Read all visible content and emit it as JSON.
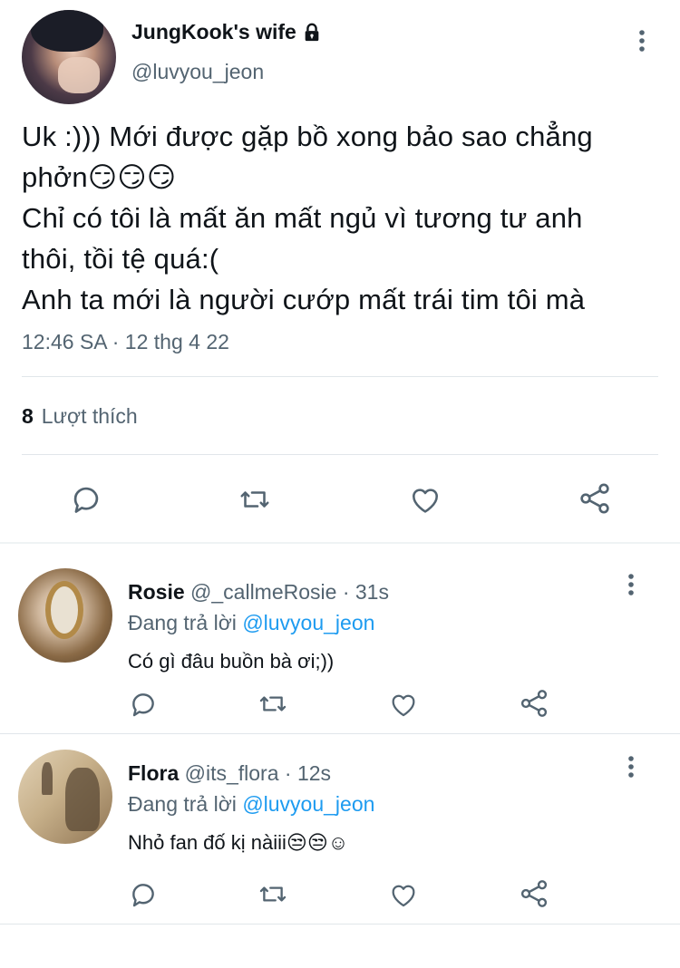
{
  "main_tweet": {
    "display_name": "JungKook's wife",
    "handle": "@luvyou_jeon",
    "protected_icon": "lock-icon",
    "text": "Uk :))) Mới được gặp bồ xong bảo sao chẳng\nphởn😏😏😏\nChỉ có tôi là mất ăn mất ngủ vì tương tư anh\nthôi, tồi tệ quá:(\nAnh ta mới là người cướp mất trái tim tôi mà",
    "timestamp": "12:46 SA · 12 thg 4 22",
    "likes_count": "8",
    "likes_label": "Lượt thích",
    "actions": [
      "reply-icon",
      "retweet-icon",
      "like-icon",
      "share-icon"
    ]
  },
  "replies": [
    {
      "display_name": "Rosie",
      "handle": "@_callmeRosie",
      "time": "· 31s",
      "replying_prefix": "Đang trả lời",
      "replying_to": "@luvyou_jeon",
      "text": "Có gì đâu buồn bà ơi;))"
    },
    {
      "display_name": "Flora",
      "handle": "@its_flora",
      "time": "· 12s",
      "replying_prefix": "Đang trả lời",
      "replying_to": "@luvyou_jeon",
      "text": "Nhỏ fan đố kị nàiii😒😒☺"
    }
  ],
  "colors": {
    "text": "#0f1419",
    "secondary": "#536471",
    "link": "#1d9bf0",
    "divider": "#e1e6ea",
    "separator": "#eff3f4"
  }
}
